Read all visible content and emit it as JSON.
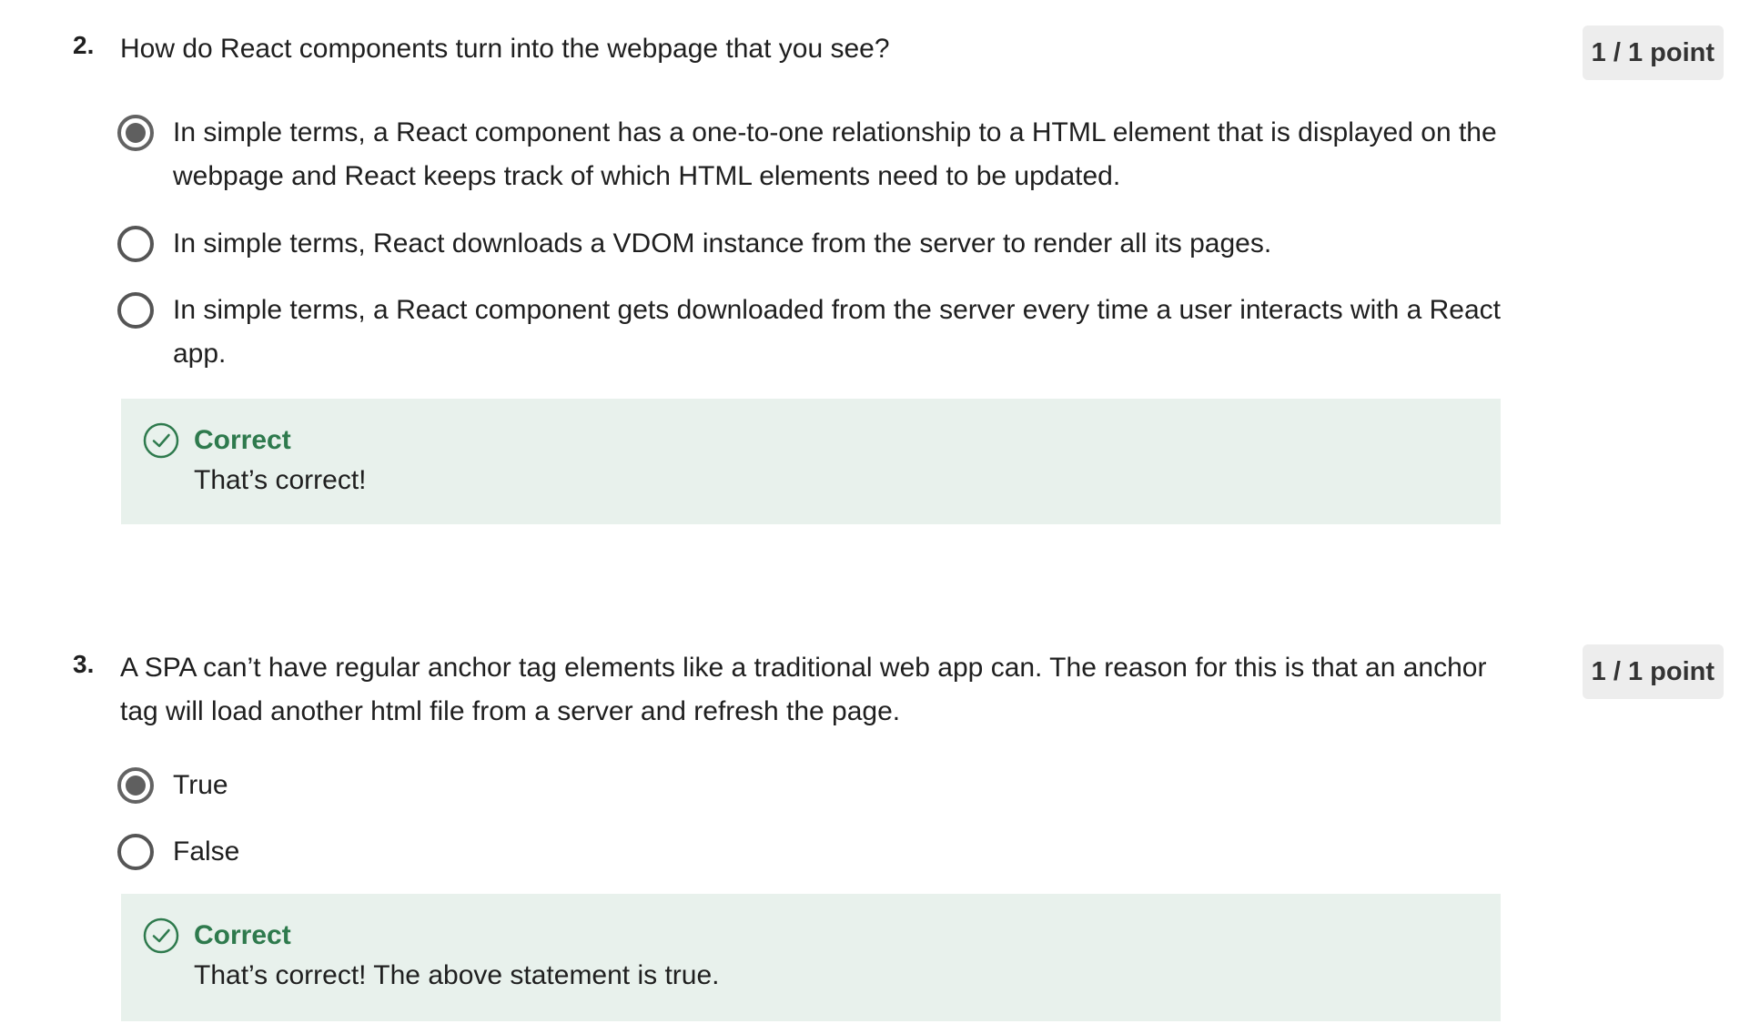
{
  "questions": [
    {
      "number": "2.",
      "text": "How do React components turn into the webpage that you see?",
      "points": "1 / 1 point",
      "options": [
        {
          "label": "In simple terms, a React component has a one-to-one relationship to a HTML element that is displayed on the webpage and React keeps track of which HTML elements need to be updated.",
          "selected": true
        },
        {
          "label": "In simple terms, React downloads a VDOM instance from the server to render all its pages.",
          "selected": false
        },
        {
          "label": "In simple terms, a React component gets downloaded from the server every time a user interacts with a React app.",
          "selected": false
        }
      ],
      "feedback": {
        "title": "Correct",
        "text": "That’s correct!",
        "icon": "check-circle-icon"
      }
    },
    {
      "number": "3.",
      "text": "A SPA can’t have regular anchor tag elements like a traditional web app can. The reason for this is that an anchor tag will load another html file from a server and refresh the page.",
      "points": "1 / 1 point",
      "options": [
        {
          "label": "True",
          "selected": true
        },
        {
          "label": "False",
          "selected": false
        }
      ],
      "feedback": {
        "title": "Correct",
        "text": "That’s correct! The above statement is true.",
        "icon": "check-circle-icon"
      }
    }
  ],
  "colors": {
    "correct_green": "#2e7a4d",
    "feedback_bg": "#e8f1ec",
    "badge_bg": "#ededed"
  }
}
